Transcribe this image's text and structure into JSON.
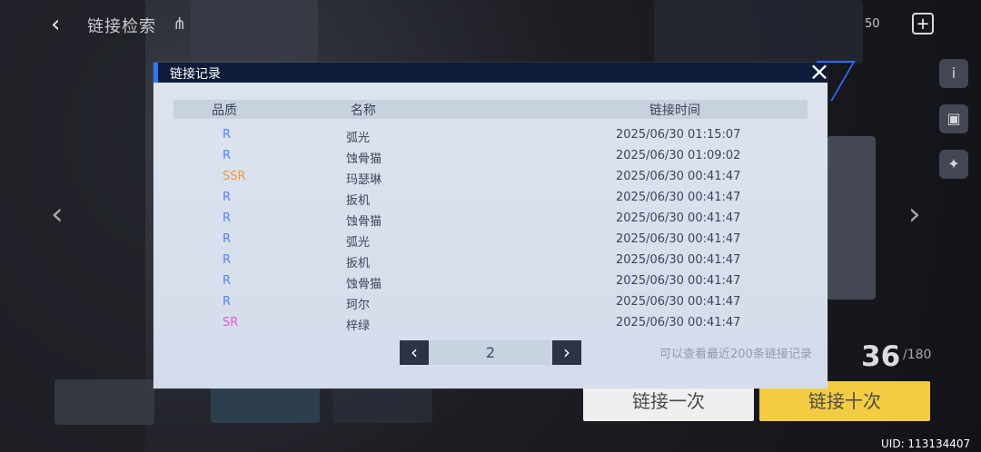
{
  "top": {
    "title": "链接检索",
    "count": "50"
  },
  "modal": {
    "title": "链接记录",
    "close_label": "×",
    "headers": {
      "quality": "品质",
      "name": "名称",
      "time": "链接时间"
    },
    "rows": [
      {
        "quality": "R",
        "name": "弧光",
        "time": "2025/06/30 01:15:07"
      },
      {
        "quality": "R",
        "name": "蚀骨猫",
        "time": "2025/06/30 01:09:02"
      },
      {
        "quality": "SSR",
        "name": "玛瑟琳",
        "time": "2025/06/30 00:41:47"
      },
      {
        "quality": "R",
        "name": "扳机",
        "time": "2025/06/30 00:41:47"
      },
      {
        "quality": "R",
        "name": "蚀骨猫",
        "time": "2025/06/30 00:41:47"
      },
      {
        "quality": "R",
        "name": "弧光",
        "time": "2025/06/30 00:41:47"
      },
      {
        "quality": "R",
        "name": "扳机",
        "time": "2025/06/30 00:41:47"
      },
      {
        "quality": "R",
        "name": "蚀骨猫",
        "time": "2025/06/30 00:41:47"
      },
      {
        "quality": "R",
        "name": "珂尔",
        "time": "2025/06/30 00:41:47"
      },
      {
        "quality": "SR",
        "name": "梓绿",
        "time": "2025/06/30 00:41:47"
      }
    ],
    "pagination": {
      "prev": "‹",
      "page": "2",
      "next": "›"
    },
    "note": "可以查看最近200条链接记录"
  },
  "bottom": {
    "btn_once": "链接一次",
    "btn_ten": "链接十次",
    "uid": "UID: 113134407",
    "counter": "36",
    "counter_small": "/180"
  },
  "colors": {
    "R": "#4b86ff",
    "SR": "#d85ddb",
    "SSR": "#f39b2b"
  }
}
